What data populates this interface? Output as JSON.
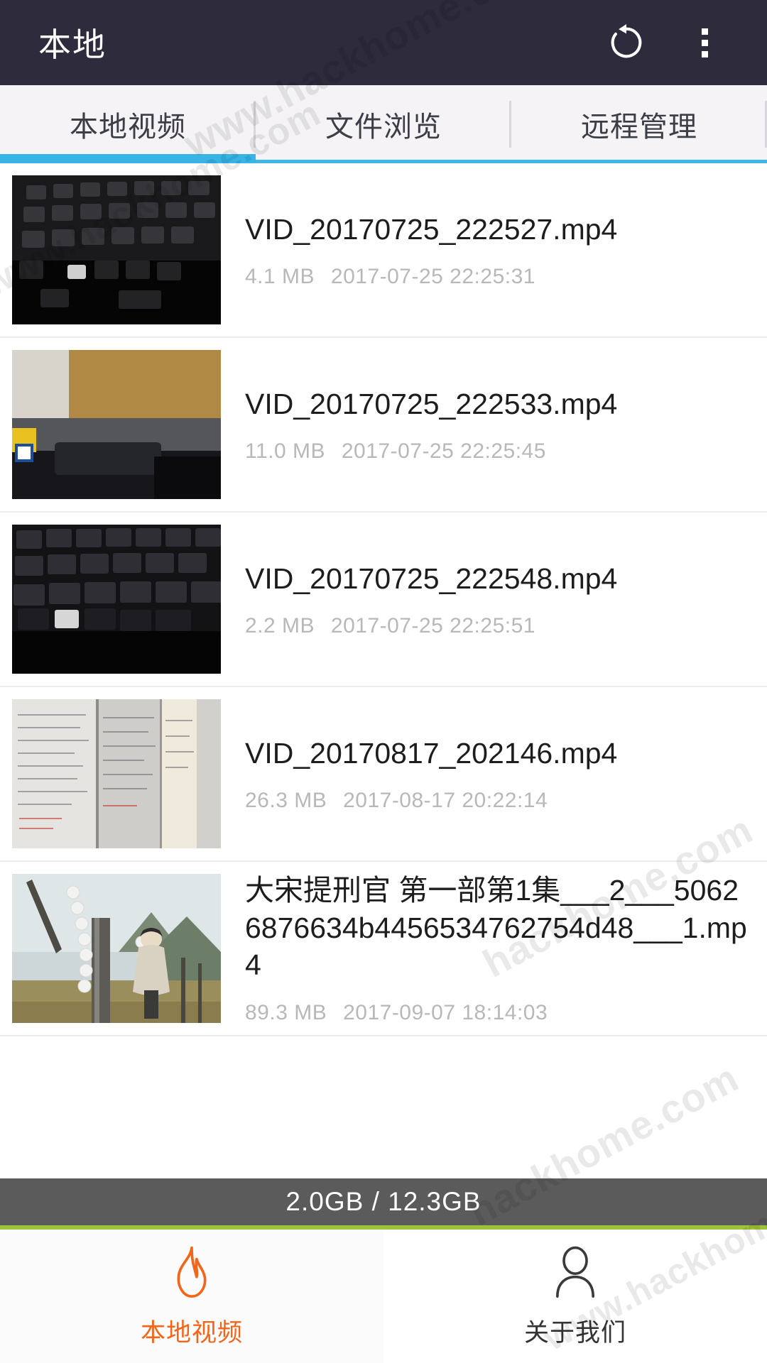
{
  "appbar": {
    "title": "本地",
    "refresh_icon": "refresh-icon",
    "overflow_icon": "more-vertical-icon"
  },
  "tabs": {
    "items": [
      {
        "label": "本地视频",
        "active": true
      },
      {
        "label": "文件浏览",
        "active": false
      },
      {
        "label": "远程管理",
        "active": false
      }
    ],
    "indicator_color": "#36b4e5",
    "track_color": "#3fb6e3"
  },
  "list": {
    "items": [
      {
        "title": "VID_20170725_222527.mp4",
        "size": "4.1 MB",
        "date": "2017-07-25 22:25:31",
        "thumb": "dark-keyboard"
      },
      {
        "title": "VID_20170725_222533.mp4",
        "size": "11.0 MB",
        "date": "2017-07-25 22:25:45",
        "thumb": "desk-wall"
      },
      {
        "title": "VID_20170725_222548.mp4",
        "size": "2.2 MB",
        "date": "2017-07-25 22:25:51",
        "thumb": "keyboard-closeup"
      },
      {
        "title": "VID_20170817_202146.mp4",
        "size": "26.3 MB",
        "date": "2017-08-17 20:22:14",
        "thumb": "document-screen"
      },
      {
        "title": "大宋提刑官 第一部第1集___2___50626876634b4456534762754d48___1.mp4",
        "size": "89.3 MB",
        "date": "2017-09-07 18:14:03",
        "thumb": "outdoor-statue"
      }
    ]
  },
  "storage": {
    "text": "2.0GB / 12.3GB",
    "used": "2.0GB",
    "total": "12.3GB",
    "accent_color": "#9ec23a"
  },
  "bottomnav": {
    "items": [
      {
        "label": "本地视频",
        "icon": "flame-icon",
        "active": true
      },
      {
        "label": "关于我们",
        "icon": "person-icon",
        "active": false
      }
    ],
    "active_color": "#f4651a"
  },
  "watermarks": {
    "text": "www.hackhome.com",
    "short": "hackhome.com"
  }
}
